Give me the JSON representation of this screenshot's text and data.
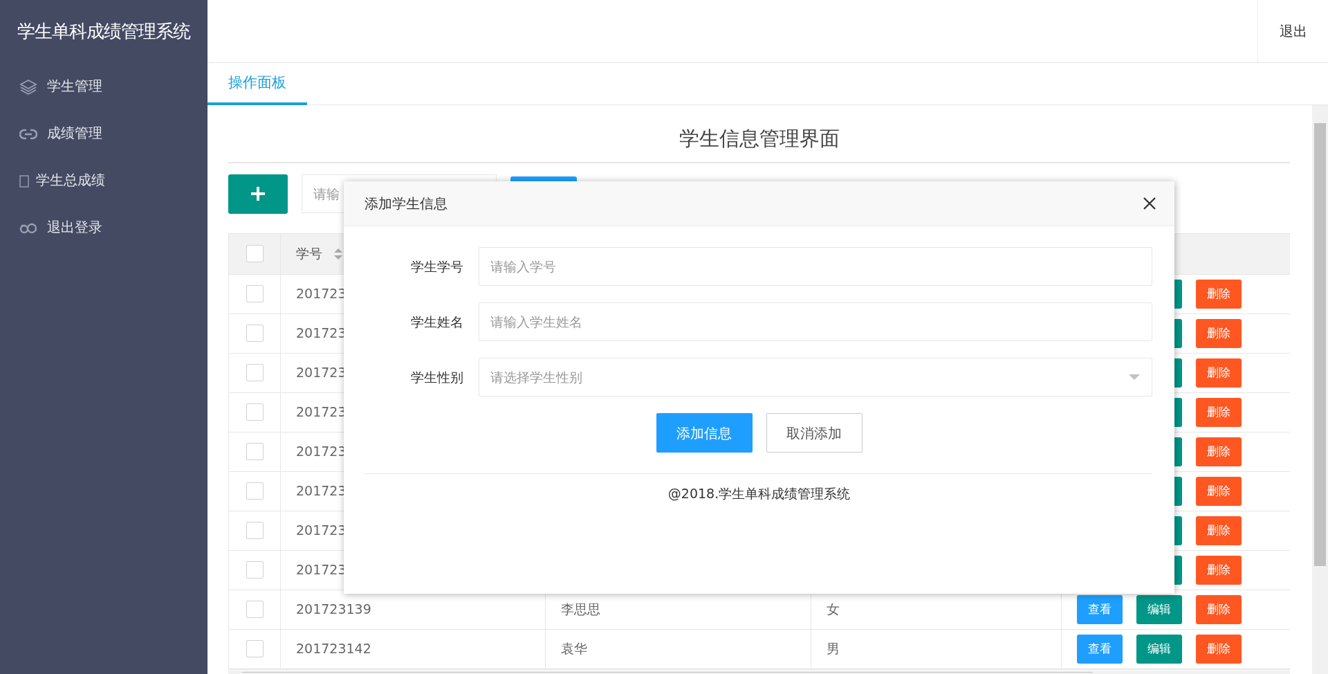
{
  "app": {
    "title": "学生单科成绩管理系统",
    "logout": "退出"
  },
  "sidebar": {
    "items": [
      {
        "label": "学生管理"
      },
      {
        "label": "成绩管理"
      },
      {
        "label": "学生总成绩"
      },
      {
        "label": "退出登录"
      }
    ]
  },
  "tabs": [
    {
      "label": "操作面板",
      "selected": true
    }
  ],
  "panel": {
    "title": "学生信息管理界面",
    "search": {
      "placeholder": "请输"
    },
    "table": {
      "select_all": false,
      "columns": [
        {
          "label": "学号",
          "sortable": true
        }
      ],
      "rows": [
        {
          "selected": false,
          "student_id": "201723",
          "actions": [
            {
              "kind": "edit"
            },
            {
              "kind": "delete",
              "label": "删除"
            }
          ]
        },
        {
          "selected": false,
          "student_id": "201723",
          "actions": [
            {
              "kind": "edit"
            },
            {
              "kind": "delete",
              "label": "删除"
            }
          ]
        },
        {
          "selected": false,
          "student_id": "201723",
          "actions": [
            {
              "kind": "edit"
            },
            {
              "kind": "delete",
              "label": "删除"
            }
          ]
        },
        {
          "selected": false,
          "student_id": "201723",
          "actions": [
            {
              "kind": "edit"
            },
            {
              "kind": "delete",
              "label": "删除"
            }
          ]
        },
        {
          "selected": false,
          "student_id": "201723",
          "actions": [
            {
              "kind": "edit"
            },
            {
              "kind": "delete",
              "label": "删除"
            }
          ]
        },
        {
          "selected": false,
          "student_id": "201723",
          "actions": [
            {
              "kind": "edit"
            },
            {
              "kind": "delete",
              "label": "删除"
            }
          ]
        },
        {
          "selected": false,
          "student_id": "201723",
          "actions": [
            {
              "kind": "edit"
            },
            {
              "kind": "delete",
              "label": "删除"
            }
          ]
        },
        {
          "selected": false,
          "student_id": "201723",
          "actions": [
            {
              "kind": "edit"
            },
            {
              "kind": "delete",
              "label": "删除"
            }
          ]
        },
        {
          "selected": false,
          "student_id": "201723139",
          "name": "李思思",
          "sex": "女",
          "actions": [
            {
              "kind": "view",
              "label": "查看"
            },
            {
              "kind": "edit",
              "label": "编辑"
            },
            {
              "kind": "delete",
              "label": "删除"
            }
          ]
        },
        {
          "selected": false,
          "student_id": "201723142",
          "name": "袁华",
          "sex": "男",
          "actions": [
            {
              "kind": "view",
              "label": "查看"
            },
            {
              "kind": "edit",
              "label": "编辑"
            },
            {
              "kind": "delete",
              "label": "删除"
            }
          ]
        }
      ]
    }
  },
  "modal": {
    "title": "添加学生信息",
    "fields": [
      {
        "label": "学生学号",
        "kind": "text",
        "placeholder": "请输入学号"
      },
      {
        "label": "学生姓名",
        "kind": "text",
        "placeholder": "请输入学生姓名"
      },
      {
        "label": "学生性别",
        "kind": "select",
        "placeholder": "请选择学生性别"
      }
    ],
    "buttons": [
      {
        "label": "添加信息",
        "kind": "primary"
      },
      {
        "label": "取消添加",
        "kind": "secondary"
      }
    ],
    "footer": "@2018.学生单科成绩管理系统"
  }
}
